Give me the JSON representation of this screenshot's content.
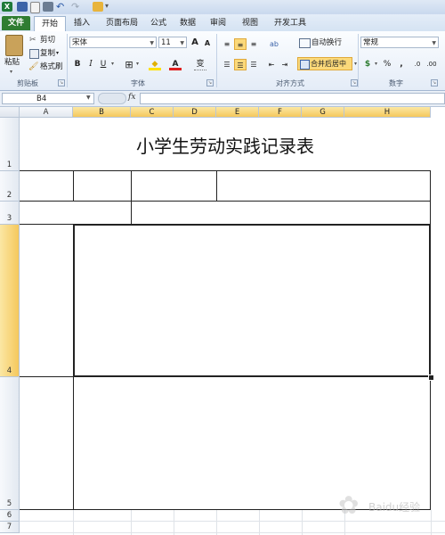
{
  "app": {
    "quick_access_more": "▾",
    "qa_icons": [
      "excel-logo-icon",
      "save-icon",
      "doc-icon",
      "print-icon",
      "undo-icon",
      "redo-icon",
      "folder-icon"
    ]
  },
  "tabs": [
    {
      "label": "文件",
      "kind": "file"
    },
    {
      "label": "开始",
      "kind": "active"
    },
    {
      "label": "插入",
      "kind": "normal"
    },
    {
      "label": "页面布局",
      "kind": "normal"
    },
    {
      "label": "公式",
      "kind": "normal"
    },
    {
      "label": "数据",
      "kind": "normal"
    },
    {
      "label": "审阅",
      "kind": "normal"
    },
    {
      "label": "视图",
      "kind": "normal"
    },
    {
      "label": "开发工具",
      "kind": "normal"
    }
  ],
  "ribbon": {
    "clipboard": {
      "paste": "粘贴",
      "cut": "剪切",
      "copy": "复制",
      "copy_arrow": "▾",
      "format_painter": "格式刷",
      "group": "剪贴板"
    },
    "font": {
      "name": "宋体",
      "size": "11",
      "grow": "A",
      "shrink": "A",
      "bold": "B",
      "italic": "I",
      "underline": "U",
      "border": "⊞",
      "fill": "◆",
      "color": "A",
      "wen": "变",
      "group": "字体"
    },
    "align": {
      "wrap": "自动换行",
      "merge": "合并后居中",
      "group": "对齐方式"
    },
    "number": {
      "format": "常规",
      "percent": "%",
      "comma": ",",
      "currency": "$",
      "group": "数字"
    },
    "launcher": "↘"
  },
  "formula_bar": {
    "cell_ref": "B4",
    "fx": "fx",
    "value": ""
  },
  "columns": [
    {
      "label": "A",
      "selected": false
    },
    {
      "label": "B",
      "selected": true
    },
    {
      "label": "C",
      "selected": true
    },
    {
      "label": "D",
      "selected": true
    },
    {
      "label": "E",
      "selected": true
    },
    {
      "label": "F",
      "selected": true
    },
    {
      "label": "G",
      "selected": true
    },
    {
      "label": "H",
      "selected": true
    }
  ],
  "rows": [
    {
      "label": "1",
      "selected": false
    },
    {
      "label": "2",
      "selected": false
    },
    {
      "label": "3",
      "selected": false
    },
    {
      "label": "4",
      "selected": true
    },
    {
      "label": "5",
      "selected": false
    },
    {
      "label": "6",
      "selected": false
    },
    {
      "label": "7",
      "selected": false
    }
  ],
  "sheet": {
    "title": "小学生劳动实践记录表"
  },
  "watermark": "Baidu经验"
}
